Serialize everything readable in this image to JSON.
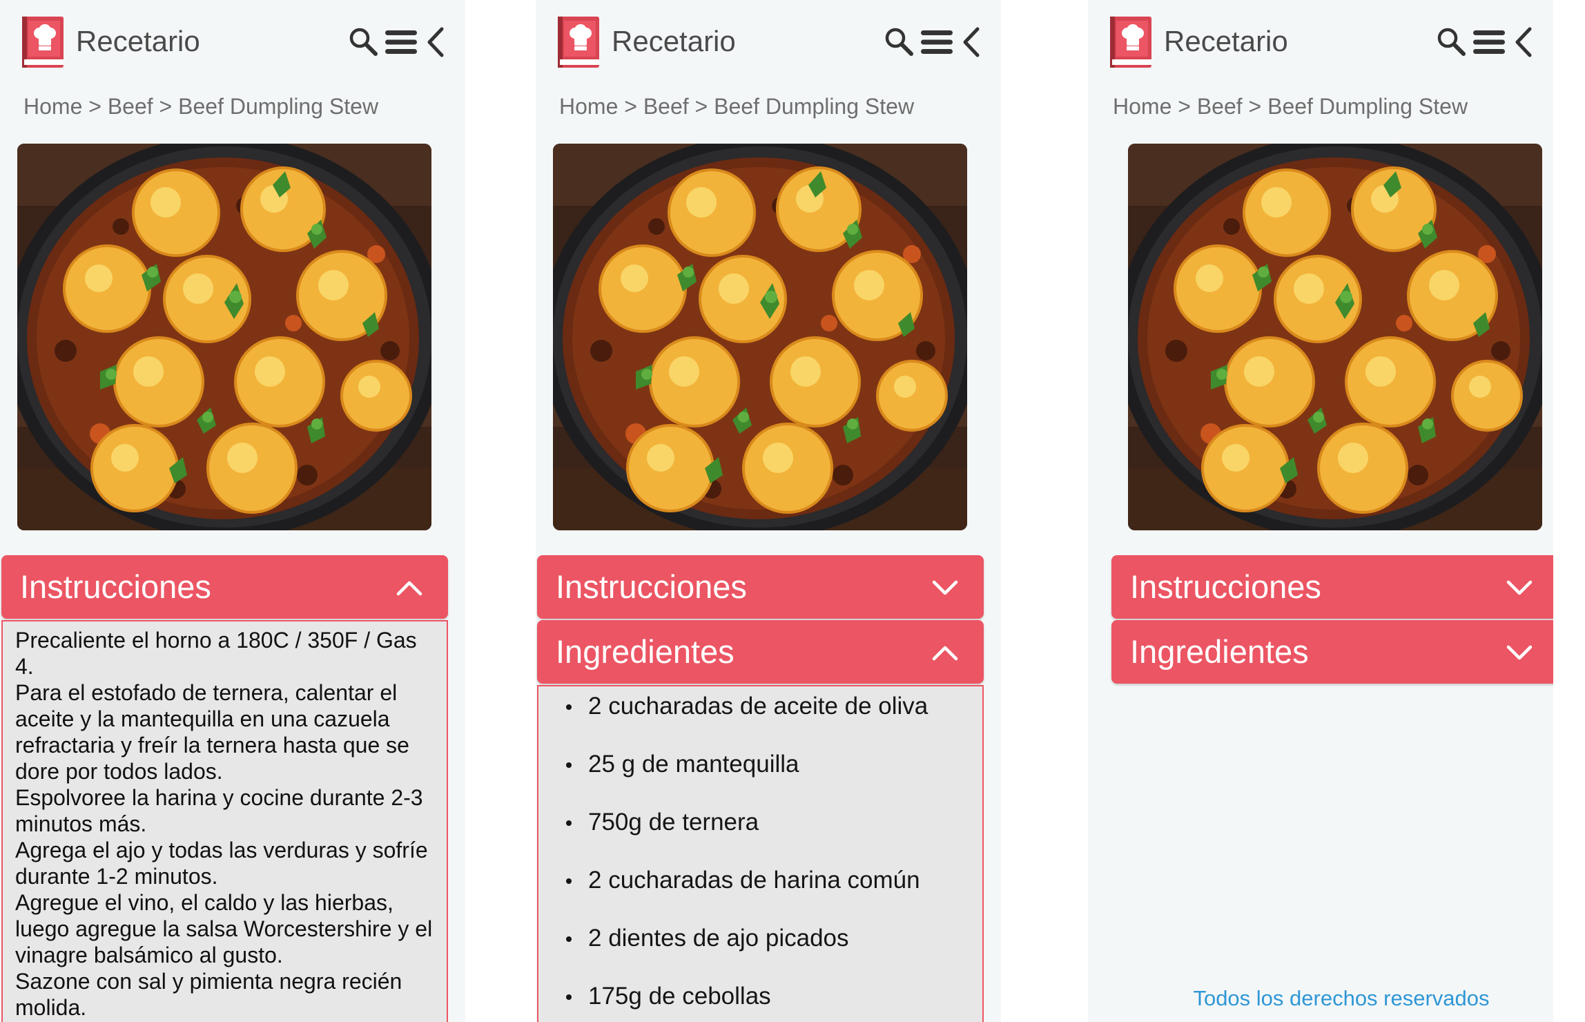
{
  "app": {
    "title": "Recetario",
    "accent_color": "#ec5563",
    "icons": [
      "recipe-book-logo",
      "search-icon",
      "hamburger-menu-icon",
      "back-chevron-icon"
    ]
  },
  "breadcrumb": {
    "home": "Home",
    "sep1": ">",
    "category": "Beef",
    "sep2": ">",
    "current": "Beef Dumpling Stew"
  },
  "image": {
    "alt": "Beef Dumpling Stew"
  },
  "sections": {
    "instructions_label": "Instrucciones",
    "ingredients_label": "Ingredientes"
  },
  "instructions_lines": [
    "Precaliente el horno a 180C / 350F / Gas",
    "4.",
    "Para el estofado de ternera, calentar el",
    "aceite y la mantequilla en una cazuela",
    "refractaria y freír la ternera hasta que se",
    "dore por todos lados.",
    "Espolvoree la harina y cocine durante 2-3",
    "minutos más.",
    "Agrega el ajo y todas las verduras y sofríe",
    "durante 1-2 minutos.",
    "Agregue el vino, el caldo y las hierbas,",
    "luego agregue la salsa Worcestershire y el",
    "vinagre balsámico al gusto.",
    "Sazone con sal y pimienta negra recién",
    "molida."
  ],
  "ingredients": [
    "2 cucharadas de aceite de oliva",
    "25 g de mantequilla",
    "750g de ternera",
    "2 cucharadas de harina común",
    "2 dientes de ajo picados",
    "175g de cebollas"
  ],
  "screens": [
    {
      "instructions_expanded": true,
      "ingredients_visible": false,
      "ingredients_expanded": false
    },
    {
      "instructions_expanded": false,
      "ingredients_visible": true,
      "ingredients_expanded": true
    },
    {
      "instructions_expanded": false,
      "ingredients_visible": true,
      "ingredients_expanded": false
    }
  ],
  "footer": {
    "text": "Todos los derechos reservados"
  }
}
